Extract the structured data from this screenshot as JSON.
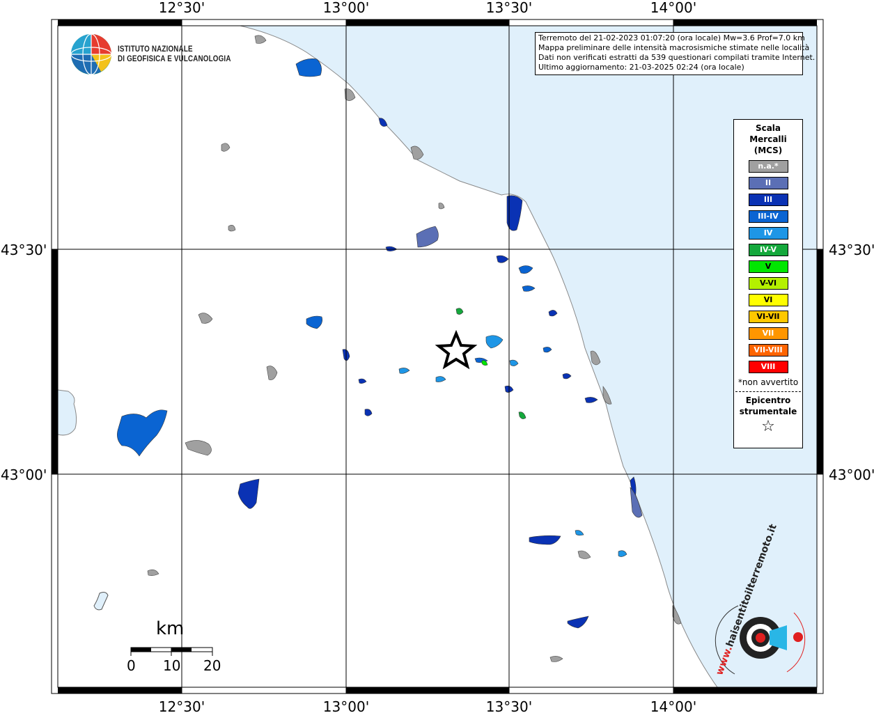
{
  "map": {
    "lon_labels": [
      "12°30'",
      "13°00'",
      "13°30'",
      "14°00'"
    ],
    "lat_labels": [
      "43°30'",
      "43°00'"
    ],
    "epicenter_icon": "star-icon"
  },
  "info_box": {
    "line1": "Terremoto del 21-02-2023 01:07:20 (ora locale) Mw=3.6 Prof=7.0 km",
    "line2": "Mappa preliminare delle intensità macrosismiche stimate nelle località",
    "line3": "Dati non verificati estratti da 539 questionari compilati tramite Internet.",
    "line4": "Ultimo aggiornamento: 21-03-2025 02:24 (ora locale)"
  },
  "logo": {
    "line1": "ISTITUTO NAZIONALE",
    "line2": "DI GEOFISICA E VULCANOLOGIA"
  },
  "legend": {
    "title1": "Scala",
    "title2": "Mercalli",
    "title3": "(MCS)",
    "items": [
      {
        "label": "n.a.*",
        "color": "#a0a0a0"
      },
      {
        "label": "II",
        "color": "#5b6fb5"
      },
      {
        "label": "III",
        "color": "#0a32b4"
      },
      {
        "label": "III-IV",
        "color": "#0a64d2"
      },
      {
        "label": "IV",
        "color": "#1e96e6"
      },
      {
        "label": "IV-V",
        "color": "#14a83c"
      },
      {
        "label": "V",
        "color": "#00e600"
      },
      {
        "label": "V-VI",
        "color": "#b4f000"
      },
      {
        "label": "VI",
        "color": "#ffff00"
      },
      {
        "label": "VI-VII",
        "color": "#ffc800"
      },
      {
        "label": "VII",
        "color": "#ff9600"
      },
      {
        "label": "VII-VIII",
        "color": "#ff6400"
      },
      {
        "label": "VIII",
        "color": "#ff0000"
      }
    ],
    "note": "*non avvertito",
    "epi1": "Epicentro",
    "epi2": "strumentale",
    "star": "☆"
  },
  "scale_bar": {
    "unit": "km",
    "labels": [
      "0",
      "10",
      "20"
    ]
  },
  "hsi_logo": {
    "text": "haisentitoilterremoto.it",
    "prefix": "www."
  },
  "colors": {
    "sea": "#e0f0fb",
    "land": "#ffffff",
    "grid": "#000000"
  }
}
